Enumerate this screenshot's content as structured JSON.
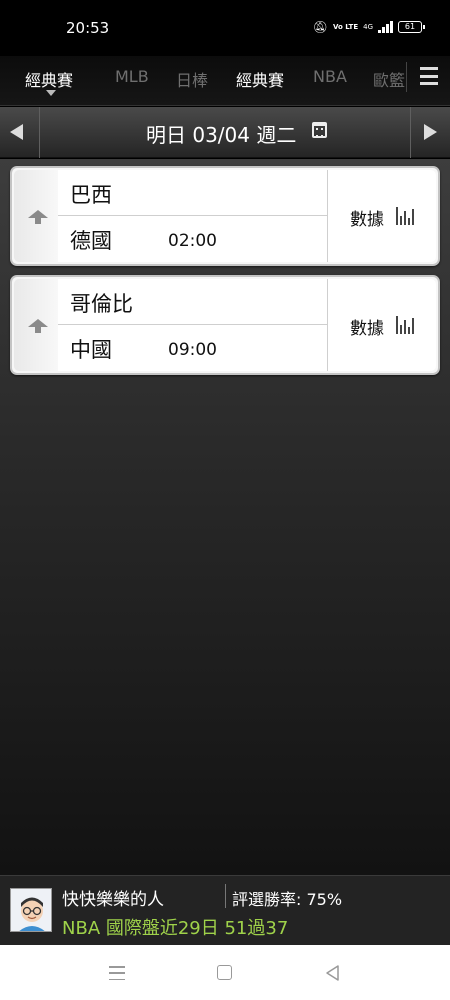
{
  "status_bar": {
    "time": "20:53",
    "network_label": "Vo LTE",
    "network_type": "4G",
    "battery": "61",
    "icons": [
      "mute-icon",
      "volte-icon",
      "signal-icon",
      "battery-icon"
    ]
  },
  "tabs": [
    {
      "label": "經典賽",
      "active": true
    },
    {
      "label": "MLB",
      "active": false
    },
    {
      "label": "日棒",
      "active": false
    },
    {
      "label": "經典賽",
      "active": false
    },
    {
      "label": "NBA",
      "active": false
    },
    {
      "label": "歐籃",
      "active": false
    }
  ],
  "date_bar": {
    "label": "明日 03/04 週二",
    "icons": [
      "prev-day-arrow-icon",
      "calendar-icon",
      "next-day-arrow-icon"
    ]
  },
  "matches": [
    {
      "home": "巴西",
      "away": "德國",
      "time": "02:00",
      "stats_label": "數據"
    },
    {
      "home": "哥倫比",
      "away": "中國",
      "time": "09:00",
      "stats_label": "數據"
    }
  ],
  "user_panel": {
    "name": "快快樂樂的人",
    "win_rate_label": "評選勝率:",
    "win_rate_value": "75%",
    "record": "NBA 國際盤近29日 51過37"
  },
  "colors": {
    "record_text": "#9fd24a",
    "active_tab": "#ffffff",
    "inactive_tab": "#6f6f6f",
    "card_background": "#f7f7f7"
  }
}
